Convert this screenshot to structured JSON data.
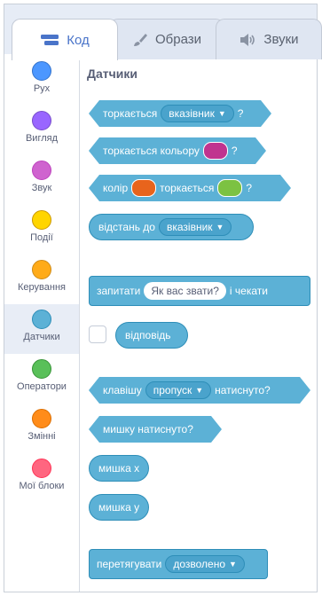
{
  "tabs": [
    {
      "label": "Код",
      "icon": "code-icon",
      "active": true
    },
    {
      "label": "Образи",
      "icon": "brush-icon",
      "active": false
    },
    {
      "label": "Звуки",
      "icon": "speaker-icon",
      "active": false
    }
  ],
  "categories": [
    {
      "label": "Рух",
      "color": "#4c97ff"
    },
    {
      "label": "Вигляд",
      "color": "#9966ff"
    },
    {
      "label": "Звук",
      "color": "#cf63cf"
    },
    {
      "label": "Події",
      "color": "#ffd500"
    },
    {
      "label": "Керування",
      "color": "#ffab19"
    },
    {
      "label": "Датчики",
      "color": "#5cb1d6",
      "selected": true
    },
    {
      "label": "Оператори",
      "color": "#59c059"
    },
    {
      "label": "Змінні",
      "color": "#ff8c1a"
    },
    {
      "label": "Мої блоки",
      "color": "#ff6680"
    }
  ],
  "palette": {
    "section_title": "Датчики",
    "touching": {
      "text": "торкається",
      "dropdown": "вказівник",
      "end": "?"
    },
    "touching_color": {
      "text": "торкається кольору",
      "end": "?",
      "color": "#c0348f"
    },
    "color_touching": {
      "text1": "колір",
      "color1": "#e8641c",
      "text2": "торкається",
      "color2": "#7cc242",
      "end": "?"
    },
    "distance": {
      "text": "відстань до",
      "dropdown": "вказівник"
    },
    "ask": {
      "text1": "запитати",
      "input": "Як вас звати?",
      "text2": "і чекати"
    },
    "answer": {
      "text": "відповідь"
    },
    "key_pressed": {
      "text1": "клавішу",
      "dropdown": "пропуск",
      "text2": "натиснуто?"
    },
    "mouse_down": {
      "text": "мишку натиснуто?"
    },
    "mouse_x": {
      "text": "мишка х"
    },
    "mouse_y": {
      "text": "мишка у"
    },
    "drag_mode": {
      "text": "перетягувати",
      "dropdown": "дозволено"
    }
  }
}
